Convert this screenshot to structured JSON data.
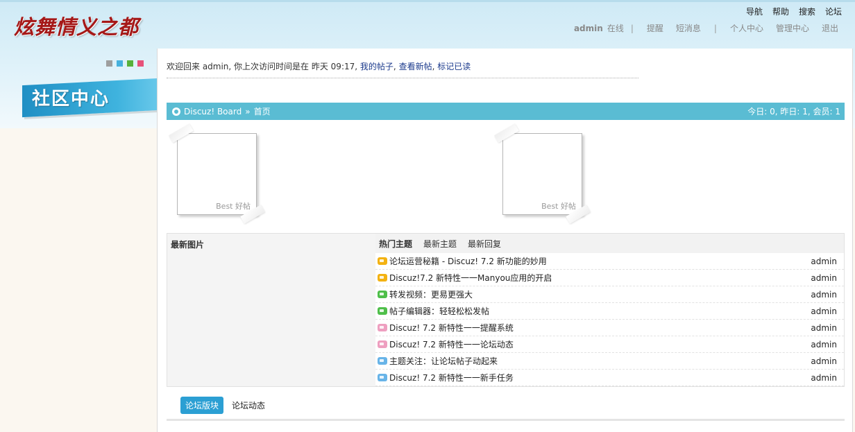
{
  "logo": {
    "text": "炫舞情义之都"
  },
  "top_nav": [
    {
      "label": "导航"
    },
    {
      "label": "帮助"
    },
    {
      "label": "搜索"
    },
    {
      "label": "论坛"
    }
  ],
  "user_bar": {
    "username": "admin",
    "status": "在线",
    "links": [
      "提醒",
      "短消息",
      "个人中心",
      "管理中心",
      "退出"
    ]
  },
  "side": {
    "title": "社区中心",
    "square_colors": [
      "#9e9e9e",
      "#47b1dd",
      "#58b13b",
      "#e7527a"
    ]
  },
  "welcome": {
    "text": "欢迎回来 admin, 你上次访问时间是在 昨天 09:17,",
    "links": [
      "我的帖子",
      "查看新帖",
      "标记已读"
    ]
  },
  "breadcrumb": {
    "site": "Discuz! Board",
    "separator": "»",
    "page": "首页",
    "stats": "今日: 0, 昨日: 1, 会员: 1"
  },
  "best_cards": [
    {
      "label": "Best 好帖"
    },
    {
      "label": "Best 好帖"
    }
  ],
  "latest_pics": {
    "title": "最新图片"
  },
  "topic_tabs": [
    {
      "label": "热门主题",
      "active": true
    },
    {
      "label": "最新主题",
      "active": false
    },
    {
      "label": "最新回复",
      "active": false
    }
  ],
  "topics": [
    {
      "title": "论坛运营秘籍 - Discuz! 7.2 新功能的妙用",
      "author": "admin",
      "icon_color": "#f3b212"
    },
    {
      "title": "Discuz!7.2 新特性一一Manyou应用的开启",
      "author": "admin",
      "icon_color": "#f3b212"
    },
    {
      "title": "转发视频：更易更强大",
      "author": "admin",
      "icon_color": "#4fbf4a"
    },
    {
      "title": "帖子编辑器：轻轻松松发帖",
      "author": "admin",
      "icon_color": "#4fbf4a"
    },
    {
      "title": "Discuz! 7.2 新特性一一提醒系统",
      "author": "admin",
      "icon_color": "#ee9fc0"
    },
    {
      "title": "Discuz! 7.2 新特性一一论坛动态",
      "author": "admin",
      "icon_color": "#ee9fc0"
    },
    {
      "title": "主题关注：让论坛帖子动起来",
      "author": "admin",
      "icon_color": "#68b4e8"
    },
    {
      "title": "Discuz! 7.2 新特性一一新手任务",
      "author": "admin",
      "icon_color": "#68b4e8"
    }
  ],
  "bottom_tabs": [
    {
      "label": "论坛版块",
      "active": true
    },
    {
      "label": "论坛动态",
      "active": false
    }
  ]
}
